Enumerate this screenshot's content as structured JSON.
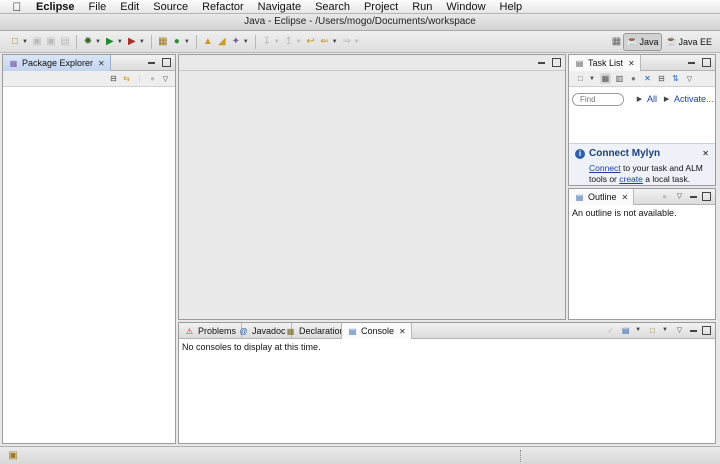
{
  "menubar": {
    "app_name": "Eclipse",
    "items": [
      "File",
      "Edit",
      "Source",
      "Refactor",
      "Navigate",
      "Search",
      "Project",
      "Run",
      "Window",
      "Help"
    ]
  },
  "window": {
    "title": "Java - Eclipse - /Users/mogo/Documents/workspace"
  },
  "toolbar": {
    "perspectives": [
      {
        "label": "Java",
        "selected": true
      },
      {
        "label": "Java EE",
        "selected": false
      }
    ]
  },
  "package_explorer": {
    "tab_label": "Package Explorer"
  },
  "task_list": {
    "tab_label": "Task List",
    "find_placeholder": "Find",
    "all_label": "All",
    "activate_label": "Activate...",
    "mylyn": {
      "title": "Connect Mylyn",
      "line1_link": "Connect",
      "line1_rest": " to your task and ALM",
      "line2_start": "tools or ",
      "line2_link": "create",
      "line2_end": " a local task."
    }
  },
  "outline": {
    "tab_label": "Outline",
    "message": "An outline is not available."
  },
  "bottom_panel": {
    "tabs": [
      {
        "label": "Problems",
        "icon": "problems-icon"
      },
      {
        "label": "Javadoc",
        "icon": "javadoc-icon"
      },
      {
        "label": "Declaration",
        "icon": "declaration-icon"
      },
      {
        "label": "Console",
        "icon": "console-icon",
        "selected": true
      }
    ],
    "console_message": "No consoles to display at this time."
  },
  "colors": {
    "active_tab": "#c2d4ee",
    "link": "#1c3ea3",
    "mylyn_title": "#1d3f7a"
  }
}
